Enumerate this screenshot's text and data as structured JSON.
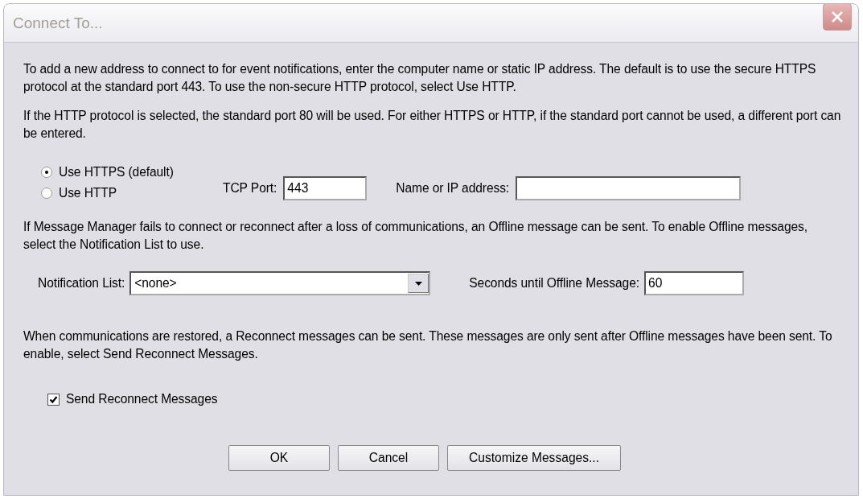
{
  "window": {
    "title": "Connect To..."
  },
  "intro": [
    "To add a new address to connect to for event notifications, enter the computer name or static IP address. The default is to use the secure HTTPS protocol at the standard port 443. To use the non-secure HTTP protocol, select Use HTTP.",
    "If the HTTP protocol is selected, the standard port 80 will be used. For either HTTPS or HTTP, if the standard port cannot be used, a different port can be entered."
  ],
  "protocols": [
    {
      "label": "Use HTTPS (default)",
      "selected": true
    },
    {
      "label": "Use HTTP",
      "selected": false
    }
  ],
  "tcp_port": {
    "label": "TCP Port:",
    "value": "443"
  },
  "address": {
    "label": "Name or IP address:"
  },
  "offline_text": "If Message Manager fails to connect or reconnect after a loss of communications, an Offline message can be sent. To enable Offline messages, select the Notification List to use.",
  "notification_list": {
    "label": "Notification List:",
    "value": "<none>"
  },
  "seconds": {
    "label": "Seconds until Offline Message:",
    "value": "60"
  },
  "reconnect_text": "When communications are restored, a Reconnect messages can be sent. These messages are only sent after Offline messages have been sent. To enable, select Send Reconnect Messages.",
  "send_reconnect": {
    "label": "Send Reconnect Messages",
    "checked": true
  },
  "buttons": [
    "OK",
    "Cancel",
    "Customize Messages..."
  ]
}
